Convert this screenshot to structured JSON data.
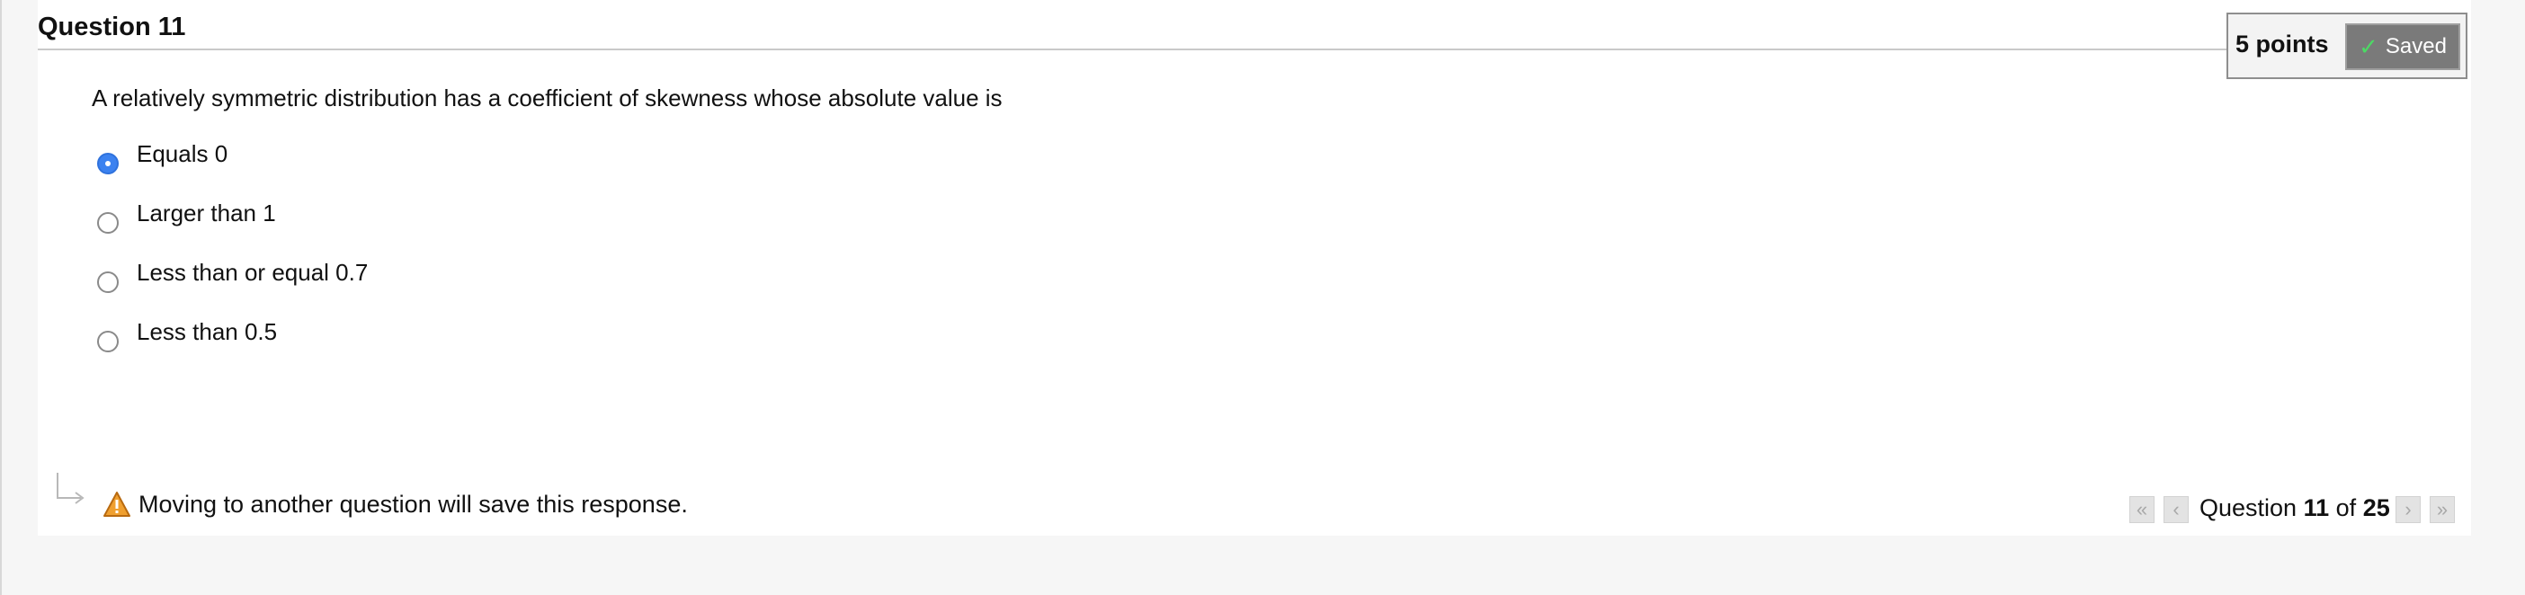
{
  "question": {
    "title": "Question 11",
    "points": "5 points",
    "save_status": "Saved",
    "prompt": "A relatively symmetric distribution has a coefficient of skewness whose absolute value is",
    "choices": [
      {
        "label": "Equals 0",
        "selected": true
      },
      {
        "label": "Larger than 1",
        "selected": false
      },
      {
        "label": "Less than or equal 0.7",
        "selected": false
      },
      {
        "label": "Less than 0.5",
        "selected": false
      }
    ]
  },
  "footer": {
    "note": "Moving to another question will save this response.",
    "nav": {
      "prefix": "Question",
      "current": "11",
      "of_label": "of",
      "total": "25"
    }
  },
  "colors": {
    "radio_selected": "#3c82f0",
    "saved_badge": "#7a7a7a",
    "check": "#4cd964",
    "warning": "#f0a030"
  }
}
